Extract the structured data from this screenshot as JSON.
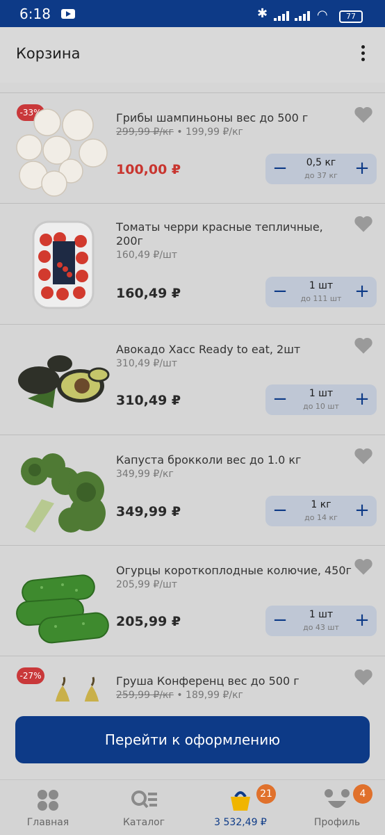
{
  "status": {
    "time": "6:18",
    "battery": "77"
  },
  "header": {
    "title": "Корзина"
  },
  "items": [
    {
      "badge": "-33%",
      "name": "Грибы  шампиньоны вес до 500 г",
      "old_price": "299,99 ₽/кг",
      "unit_price": "• 199,99 ₽/кг",
      "price": "100,00 ₽",
      "sale": true,
      "qty": "0,5 кг",
      "max": "до 37 кг"
    },
    {
      "name": "Томаты черри красные тепличные, 200г",
      "unit_price": "160,49 ₽/шт",
      "price": "160,49 ₽",
      "qty": "1 шт",
      "max": "до 111 шт"
    },
    {
      "name": "Авокадо Хасс Ready to eat, 2шт",
      "unit_price": "310,49 ₽/шт",
      "price": "310,49 ₽",
      "qty": "1 шт",
      "max": "до 10 шт"
    },
    {
      "name": "Капуста  брокколи вес до 1.0 кг",
      "unit_price": "349,99 ₽/кг",
      "price": "349,99 ₽",
      "qty": "1 кг",
      "max": "до 14 кг"
    },
    {
      "name": "Огурцы короткоплодные колючие, 450г",
      "unit_price": "205,99 ₽/шт",
      "price": "205,99 ₽",
      "qty": "1 шт",
      "max": "до 43 шт"
    },
    {
      "badge": "-27%",
      "name": "Груша  Конференц вес до 500 г",
      "old_price": "259,99 ₽/кг",
      "unit_price": "• 189,99 ₽/кг"
    }
  ],
  "checkout": {
    "label": "Перейти к оформлению"
  },
  "nav": {
    "home": "Главная",
    "catalog": "Каталог",
    "cart_total": "3 532,49 ₽",
    "cart_count": "21",
    "profile": "Профиль",
    "profile_count": "4"
  },
  "colors": {
    "brand": "#0d3a87",
    "sale": "#c8352f",
    "badge": "#e0712c"
  }
}
